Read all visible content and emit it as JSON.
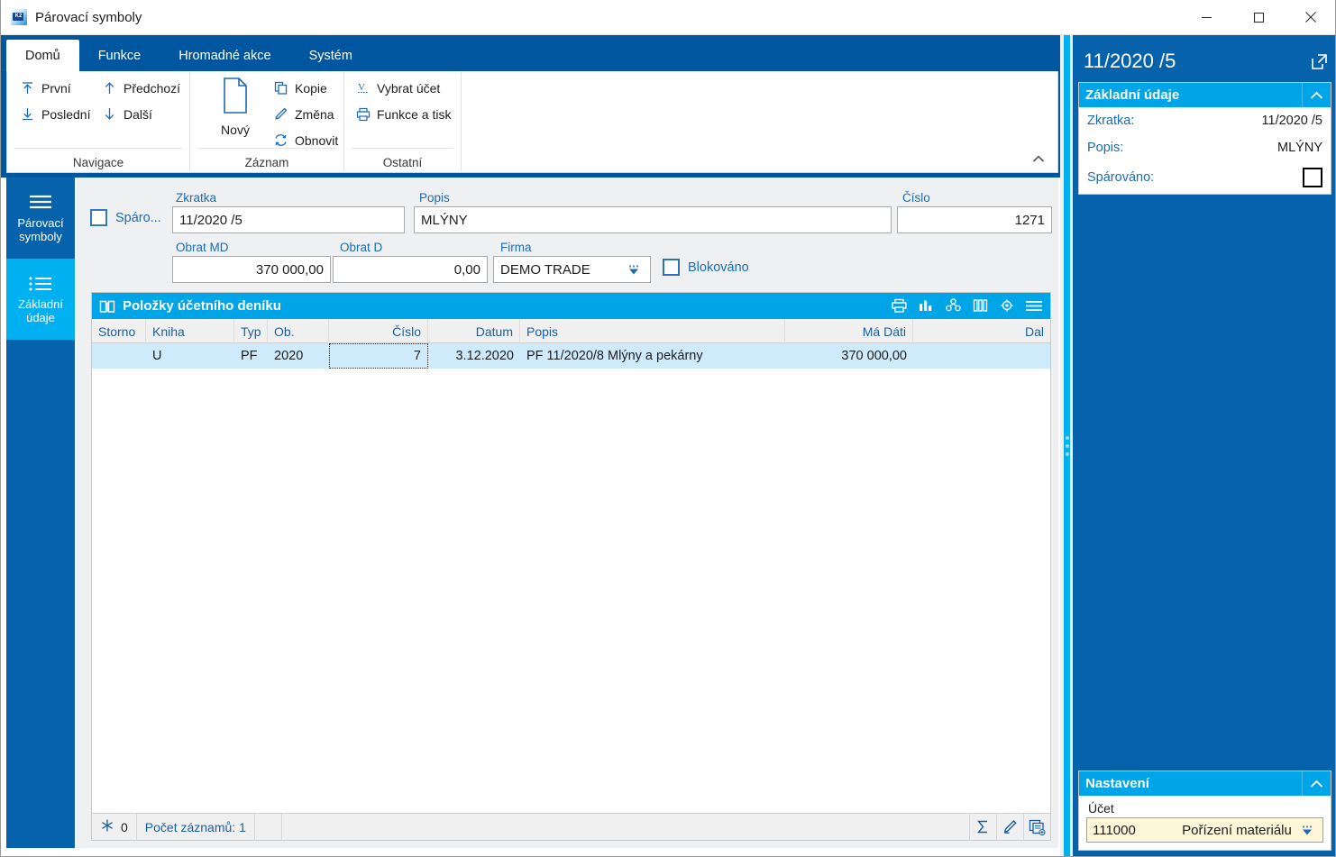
{
  "window": {
    "title": "Párovací symboly",
    "icon": "app-icon",
    "buttons": {
      "minimize": "–",
      "maximize": "☐",
      "close": "✕"
    }
  },
  "ribbon": {
    "tabs": [
      {
        "label": "Domů",
        "active": true
      },
      {
        "label": "Funkce",
        "active": false
      },
      {
        "label": "Hromadné akce",
        "active": false
      },
      {
        "label": "Systém",
        "active": false
      }
    ],
    "groups": [
      {
        "label": "Navigace",
        "commands": [
          {
            "label": "První",
            "icon": "arrow-up-to-line-icon"
          },
          {
            "label": "Předchozí",
            "icon": "arrow-up-icon"
          },
          {
            "label": "Poslední",
            "icon": "arrow-down-to-line-icon"
          },
          {
            "label": "Další",
            "icon": "arrow-down-icon"
          }
        ]
      },
      {
        "label": "Záznam",
        "big": {
          "label": "Nový",
          "icon": "new-document-icon"
        },
        "commands": [
          {
            "label": "Kopie",
            "icon": "copy-icon"
          },
          {
            "label": "Změna",
            "icon": "pencil-icon"
          },
          {
            "label": "Obnovit",
            "icon": "refresh-icon"
          }
        ]
      },
      {
        "label": "Ostatní",
        "commands": [
          {
            "label": "Vybrat účet",
            "icon": "select-account-icon"
          },
          {
            "label": "Funkce a tisk",
            "icon": "printer-icon"
          }
        ]
      }
    ],
    "collapse": "chevron-up-icon"
  },
  "leftnav": {
    "items": [
      {
        "label": "Párovací symboly",
        "icon": "list-lines-icon",
        "selected": true
      },
      {
        "label": "Základní údaje",
        "icon": "list-bullets-icon",
        "selected": false
      }
    ]
  },
  "form": {
    "matched_checkbox_label": "Spáro...",
    "matched_checked": false,
    "fields": [
      {
        "label": "Zkratka",
        "value": "11/2020 /5"
      },
      {
        "label": "Popis",
        "value": "MLÝNY"
      },
      {
        "label": "Číslo",
        "value": "1271"
      },
      {
        "label": "Obrat MD",
        "value": "370 000,00"
      },
      {
        "label": "Obrat D",
        "value": "0,00"
      },
      {
        "label": "Firma",
        "value": "DEMO TRADE"
      }
    ],
    "blocked_label": "Blokováno",
    "blocked_checked": false
  },
  "grid": {
    "title": "Položky účetního deníku",
    "title_icon": "book-icon",
    "tools": [
      "printer-icon",
      "bar-chart-icon",
      "pivot-icon",
      "columns-icon",
      "settings-gear-icon",
      "menu-lines-icon"
    ],
    "columns": [
      {
        "label": "Storno",
        "align": "left"
      },
      {
        "label": "Kniha",
        "align": "left"
      },
      {
        "label": "Typ",
        "align": "left"
      },
      {
        "label": "Ob.",
        "align": "left"
      },
      {
        "label": "Číslo",
        "align": "right"
      },
      {
        "label": "Datum",
        "align": "right"
      },
      {
        "label": "Popis",
        "align": "left"
      },
      {
        "label": "Má Dáti",
        "align": "right"
      },
      {
        "label": "Dal",
        "align": "right"
      }
    ],
    "rows": [
      {
        "storno": "",
        "kniha": "U",
        "typ": "PF",
        "ob": "2020",
        "cislo": "7",
        "datum": "3.12.2020",
        "popis": "PF 11/2020/8 Mlýny a pekárny",
        "ma_dati": "370 000,00",
        "dal": ""
      }
    ],
    "status": {
      "flake_icon": "snowflake-icon",
      "flake_count": "0",
      "record_count": "Počet záznamů: 1",
      "buttons": [
        "sum-sigma-icon",
        "edit-pencil-icon",
        "new-record-icon"
      ]
    }
  },
  "right_panel": {
    "header": "11/2020 /5",
    "expand_icon": "open-external-icon",
    "cards": [
      {
        "title": "Základní údaje",
        "chevron": "chevron-up-icon",
        "rows": [
          {
            "key": "Zkratka:",
            "value": "11/2020 /5",
            "type": "text"
          },
          {
            "key": "Popis:",
            "value": "MLÝNY",
            "type": "text"
          },
          {
            "key": "Spárováno:",
            "value": "",
            "type": "checkbox",
            "checked": false
          }
        ]
      }
    ],
    "settings": {
      "title": "Nastavení",
      "chevron": "chevron-up-icon",
      "account_label": "Účet",
      "account_number": "111000",
      "account_name": "Pořízení materiálu",
      "dropdown_icon": "lookup-arrow-icon"
    }
  },
  "colors": {
    "ribbon_blue": "#00569f",
    "panel_blue": "#0663ab",
    "cyan": "#00a5e8",
    "nav_cyan": "#00b0f0",
    "row_select": "#cfeafb",
    "label_blue": "#1b6cb5",
    "field_yellow": "#fdf6d9"
  }
}
